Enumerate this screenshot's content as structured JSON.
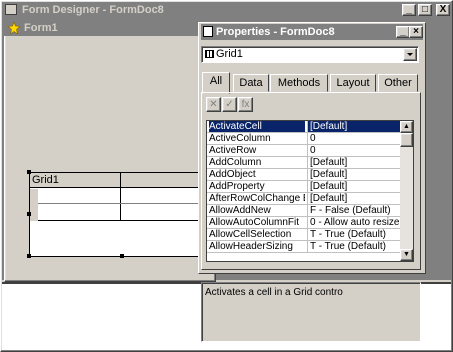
{
  "window": {
    "title": "Form Designer - FormDoc8",
    "buttons": [
      "_",
      "□",
      "X"
    ]
  },
  "form": {
    "title": "Form1",
    "grid_caption": "Grid1"
  },
  "properties": {
    "title": "Properties - FormDoc8",
    "object": "Grid1",
    "tabs": [
      "All",
      "Data",
      "Methods",
      "Layout",
      "Other"
    ],
    "active_tab": "All",
    "toolbar": {
      "cancel": "✕",
      "accept": "✓",
      "function": "fx"
    },
    "rows": [
      {
        "name": "ActivateCell",
        "value": "[Default]",
        "selected": true
      },
      {
        "name": "ActiveColumn",
        "value": "0"
      },
      {
        "name": "ActiveRow",
        "value": "0"
      },
      {
        "name": "AddColumn",
        "value": "[Default]"
      },
      {
        "name": "AddObject",
        "value": "[Default]"
      },
      {
        "name": "AddProperty",
        "value": "[Default]"
      },
      {
        "name": "AfterRowColChange E",
        "value": "[Default]"
      },
      {
        "name": "AllowAddNew",
        "value": "F - False (Default)"
      },
      {
        "name": "AllowAutoColumnFit",
        "value": "0 - Allow auto resize fo"
      },
      {
        "name": "AllowCellSelection",
        "value": "T - True (Default)"
      },
      {
        "name": "AllowHeaderSizing",
        "value": "T - True (Default)"
      }
    ],
    "description": "Activates a cell in a Grid contro"
  }
}
